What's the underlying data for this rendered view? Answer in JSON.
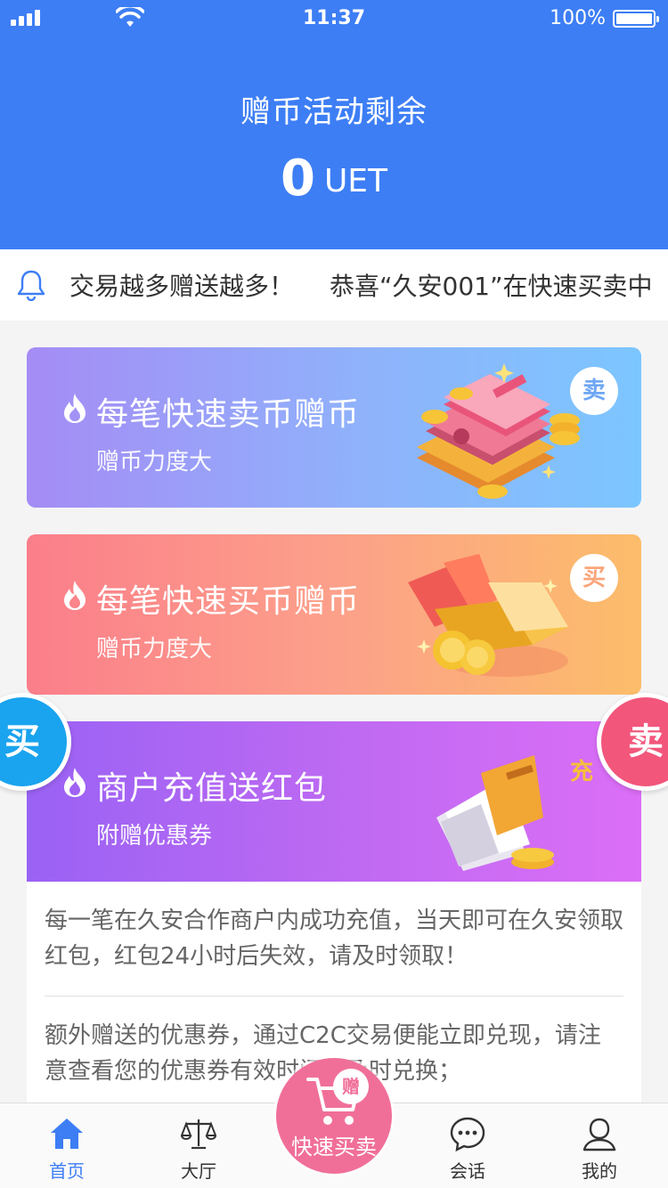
{
  "status_bar": {
    "time": "11:37",
    "battery": "100%"
  },
  "header": {
    "title": "赠币活动剩余",
    "amount": "0",
    "unit": "UET"
  },
  "notice": {
    "messages": [
      "交易越多赠送越多！",
      "恭喜“久安001”在快速买卖中"
    ]
  },
  "cards": {
    "sell": {
      "title": "每笔快速卖币赠币",
      "subtitle": "赠币力度大",
      "badge": "卖"
    },
    "buy": {
      "title": "每笔快速买币赠币",
      "subtitle": "赠币力度大",
      "badge": "买"
    },
    "recharge": {
      "title": "商户充值送红包",
      "subtitle": "附赠优惠券",
      "badge": "充"
    }
  },
  "recharge_details": [
    "每一笔在久安合作商户内成功充值，当天即可在久安领取红包，红包24小时后失效，请及时领取！",
    "额外赠送的优惠券，通过C2C交易便能立即兑现，请注意查看您的优惠券有效时间，及时兑换；"
  ],
  "side_buttons": {
    "buy": "买",
    "sell": "卖"
  },
  "tabbar": {
    "home": "首页",
    "hall": "大厅",
    "quick": "快速买卖",
    "quick_badge": "赠",
    "chat": "会话",
    "mine": "我的"
  },
  "colors": {
    "primary": "#3d7ef5",
    "fab": "#f06f99",
    "side_buy": "#1aa3ee",
    "side_sell": "#f2567b"
  }
}
